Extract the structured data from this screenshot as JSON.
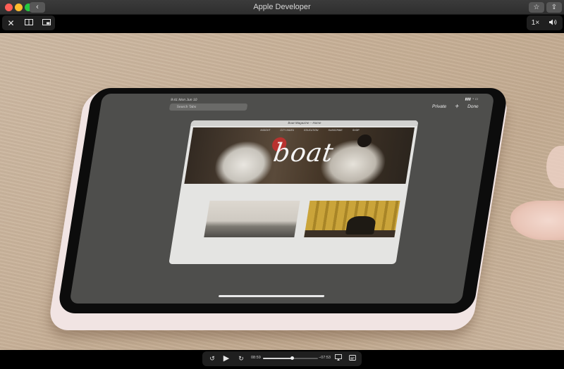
{
  "window": {
    "title": "Apple Developer",
    "back_icon": "‹",
    "bookmark_icon": "☆",
    "share_icon": "⇪"
  },
  "toolbar": {
    "close_icon": "✕",
    "split_icon": "◫",
    "pip_icon": "⧉",
    "speed_label": "1×",
    "volume_icon": "🔊"
  },
  "video": {
    "ipad": {
      "status_time": "9:41  Mon Jun 10",
      "search_placeholder": "Search Tabs",
      "private_label": "Private",
      "add_icon": "+",
      "done_label": "Done",
      "tab_title": "Boat Magazine – Home",
      "nav_items": [
        "INSIGHT",
        "CITY INDEX",
        "EDUCATION",
        "SUBSCRIBE",
        "SHOP"
      ],
      "logo_text": "boat"
    }
  },
  "playback": {
    "skip_back_icon": "↺",
    "play_icon": "▶",
    "skip_forward_icon": "↻",
    "elapsed": "08:59",
    "remaining": "−07:53",
    "progress": 0.53,
    "airplay_icon": "▭",
    "captions_icon": "☰"
  }
}
